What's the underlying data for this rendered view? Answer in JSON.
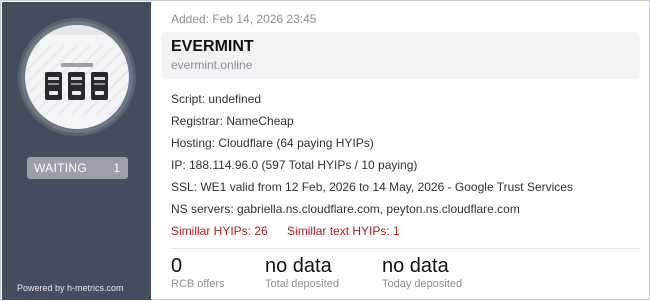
{
  "sidebar": {
    "status_label": "WAITING",
    "status_count": "1",
    "powered_by": "Powered by h-metrics.com"
  },
  "header": {
    "added": "Added: Feb 14, 2026 23:45",
    "name": "EVERMINT",
    "url": "evermint.online"
  },
  "details": {
    "script": "Script: undefined",
    "registrar": "Registrar: NameCheap",
    "hosting": "Hosting: Cloudflare (64 paying HYIPs)",
    "ip": "IP: 188.114.96.0 (597 Total HYIPs / 10 paying)",
    "ssl": "SSL: WE1 valid from 12 Feb, 2026 to 14 May, 2026 - Google Trust Services",
    "ns": "NS servers: gabriella.ns.cloudflare.com, peyton.ns.cloudflare.com"
  },
  "similar": {
    "hyips": "Simillar HYIPs: 26",
    "text": "Simillar text HYIPs: 1"
  },
  "stats": [
    {
      "value": "0",
      "label": "RCB offers"
    },
    {
      "value": "no data",
      "label": "Total deposited"
    },
    {
      "value": "no data",
      "label": "Today deposited"
    }
  ],
  "colors": {
    "sidebar_bg": "#454d5c",
    "status_badge": "#9a9fa8",
    "similar_link": "#b01f1f"
  }
}
